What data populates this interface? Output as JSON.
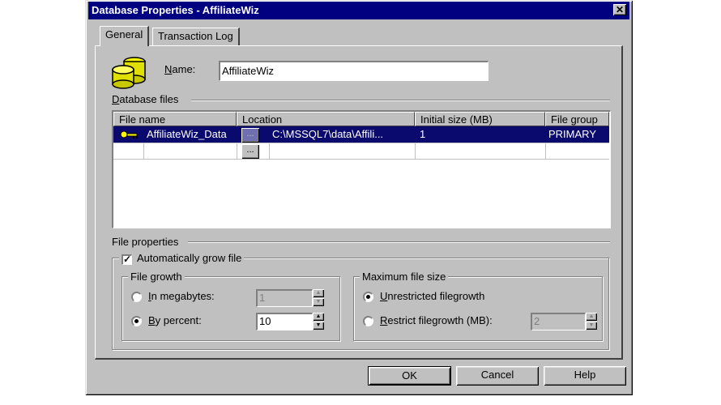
{
  "window": {
    "title": "Database Properties - AffiliateWiz",
    "close_glyph": "✕"
  },
  "tabs": [
    {
      "label": "General",
      "active": true
    },
    {
      "label": "Transaction Log",
      "active": false
    }
  ],
  "icons": {
    "db": "database-icon",
    "file_row": "key-file-icon"
  },
  "name_field": {
    "label_pre": "",
    "label_accel": "N",
    "label_post": "ame:",
    "value": "AffiliateWiz"
  },
  "database_files": {
    "label_accel": "D",
    "label_post": "atabase files",
    "columns": [
      "File name",
      "Location",
      "Initial size (MB)",
      "File group"
    ],
    "rows": [
      {
        "file_name": "AffiliateWiz_Data",
        "location": "C:\\MSSQL7\\data\\Affili...",
        "initial_size": "1",
        "file_group": "PRIMARY"
      },
      {
        "file_name": "",
        "location": "",
        "initial_size": "",
        "file_group": ""
      }
    ],
    "browse_label": "..."
  },
  "file_properties": {
    "label": "File properties",
    "auto_grow": {
      "label": "Automatically grow file",
      "checked": true,
      "mark": "✓"
    },
    "file_growth": {
      "label": "File growth",
      "megabytes": {
        "accel": "I",
        "rest": "n megabytes:",
        "value": "1",
        "selected": false
      },
      "percent": {
        "accel": "B",
        "rest": "y percent:",
        "value": "10",
        "selected": true
      }
    },
    "max_size": {
      "label": "Maximum file size",
      "unrestricted": {
        "accel": "U",
        "rest": "nrestricted filegrowth",
        "selected": true
      },
      "restrict": {
        "accel": "R",
        "rest": "estrict filegrowth (MB):",
        "value": "2",
        "selected": false
      }
    },
    "spin_up": "▲",
    "spin_down": "▼"
  },
  "buttons": {
    "ok": "OK",
    "cancel": "Cancel",
    "help": "Help"
  }
}
